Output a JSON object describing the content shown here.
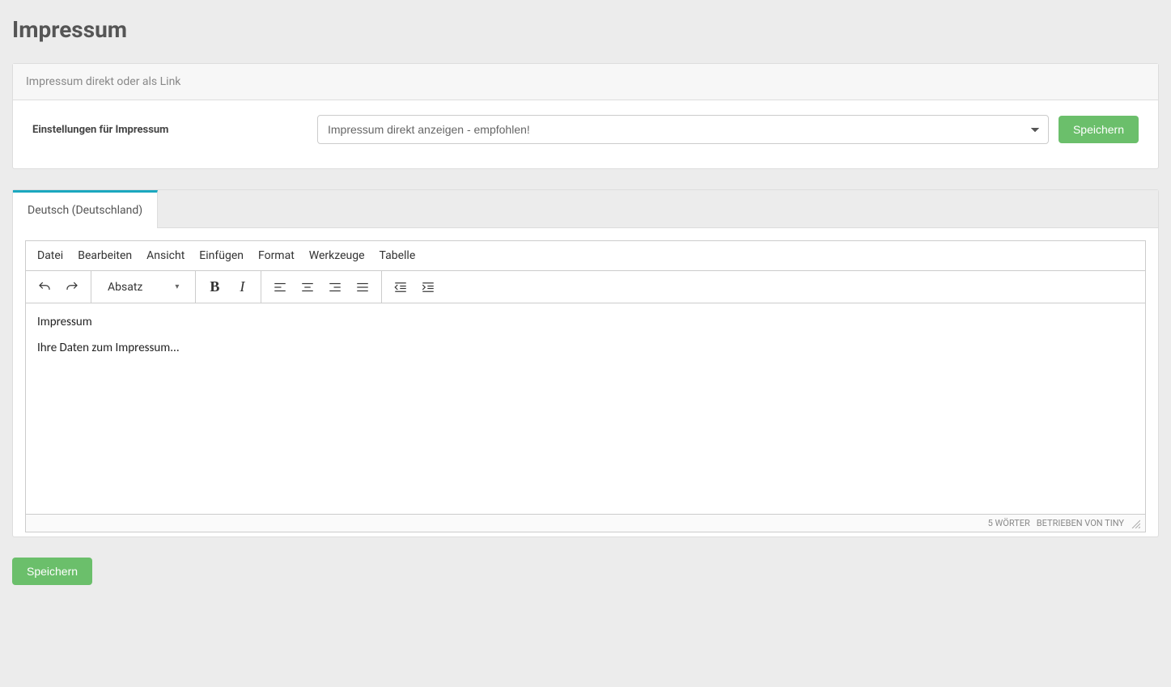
{
  "page": {
    "title": "Impressum"
  },
  "settings_panel": {
    "header": "Impressum direkt oder als Link",
    "label": "Einstellungen für Impressum",
    "select_value": "Impressum direkt anzeigen - empfohlen!",
    "save_label": "Speichern"
  },
  "tabs": {
    "active": "Deutsch (Deutschland)"
  },
  "editor": {
    "menus": {
      "file": "Datei",
      "edit": "Bearbeiten",
      "view": "Ansicht",
      "insert": "Einfügen",
      "format": "Format",
      "tools": "Werkzeuge",
      "table": "Tabelle"
    },
    "block_format": "Absatz",
    "content": {
      "line1": "Impressum",
      "line2": "Ihre Daten zum Impressum..."
    },
    "status": {
      "words": "5 WÖRTER",
      "powered": "BETRIEBEN VON TINY"
    }
  },
  "bottom": {
    "save_label": "Speichern"
  }
}
